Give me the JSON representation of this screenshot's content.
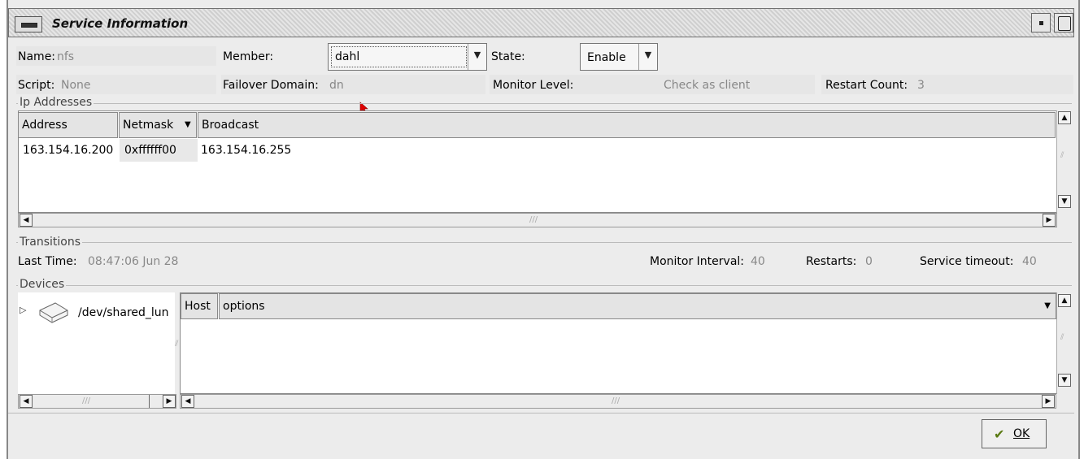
{
  "window": {
    "title": "Service Information"
  },
  "row1": {
    "name_label": "Name:",
    "name_value": "nfs",
    "member_label": "Member:",
    "member_value": "dahl",
    "state_label": "State:",
    "state_value": "Enable"
  },
  "row2": {
    "script_label": "Script:",
    "script_value": "None",
    "failover_label": "Failover Domain:",
    "failover_value": "dn",
    "monitor_level_label": "Monitor Level:",
    "monitor_level_value": "Check as client",
    "restart_count_label": "Restart Count:",
    "restart_count_value": "3"
  },
  "ip": {
    "group_title": "Ip Addresses",
    "columns": [
      "Address",
      "Netmask",
      "Broadcast"
    ],
    "rows": [
      [
        "163.154.16.200",
        "0xffffff00",
        "163.154.16.255"
      ]
    ]
  },
  "transitions": {
    "group_title": "Transitions",
    "last_time_label": "Last Time:",
    "last_time_value": "08:47:06 Jun 28",
    "monitor_interval_label": "Monitor Interval:",
    "monitor_interval_value": "40",
    "restarts_label": "Restarts:",
    "restarts_value": "0",
    "service_timeout_label": "Service timeout:",
    "service_timeout_value": "40"
  },
  "devices": {
    "group_title": "Devices",
    "tree_item": "/dev/shared_lun",
    "columns": [
      "Host",
      "options"
    ]
  },
  "buttons": {
    "ok_label": "OK"
  },
  "icons": {
    "menu": "window-menu-icon",
    "check": "check-icon",
    "disk": "disk-drive-icon",
    "expander": "triangle-right-icon"
  }
}
